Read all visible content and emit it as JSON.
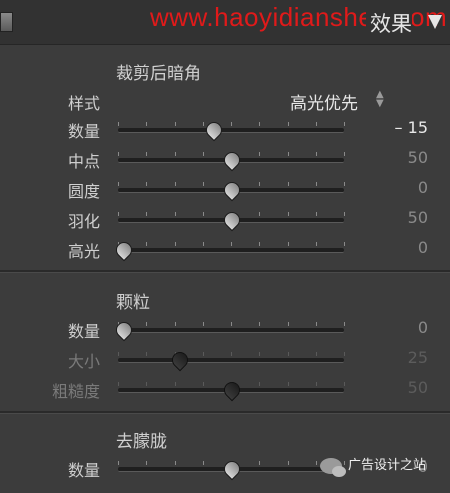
{
  "header": {
    "watermark": "www.haoyidianshe...com",
    "title": "效果"
  },
  "vignette": {
    "title": "裁剪后暗角",
    "style_label": "样式",
    "style_value": "高光优先",
    "rows": [
      {
        "label": "数量",
        "value": "– 15",
        "position": 0.42
      },
      {
        "label": "中点",
        "value": "50",
        "position": 0.5
      },
      {
        "label": "圆度",
        "value": "0",
        "position": 0.5
      },
      {
        "label": "羽化",
        "value": "50",
        "position": 0.5
      },
      {
        "label": "高光",
        "value": "0",
        "position": 0.02
      }
    ]
  },
  "grain": {
    "title": "颗粒",
    "rows": [
      {
        "label": "数量",
        "value": "0",
        "position": 0.02
      },
      {
        "label": "大小",
        "value": "25",
        "position": 0.27
      },
      {
        "label": "粗糙度",
        "value": "50",
        "position": 0.5
      }
    ]
  },
  "dehaze": {
    "title": "去朦胧",
    "rows": [
      {
        "label": "数量",
        "value": "0",
        "position": 0.5
      }
    ]
  },
  "badge": {
    "text": "广告设计之站"
  },
  "icons": [
    "panel-toggle-icon",
    "collapse-triangle-icon",
    "select-arrows-icon",
    "wechat-icon"
  ]
}
